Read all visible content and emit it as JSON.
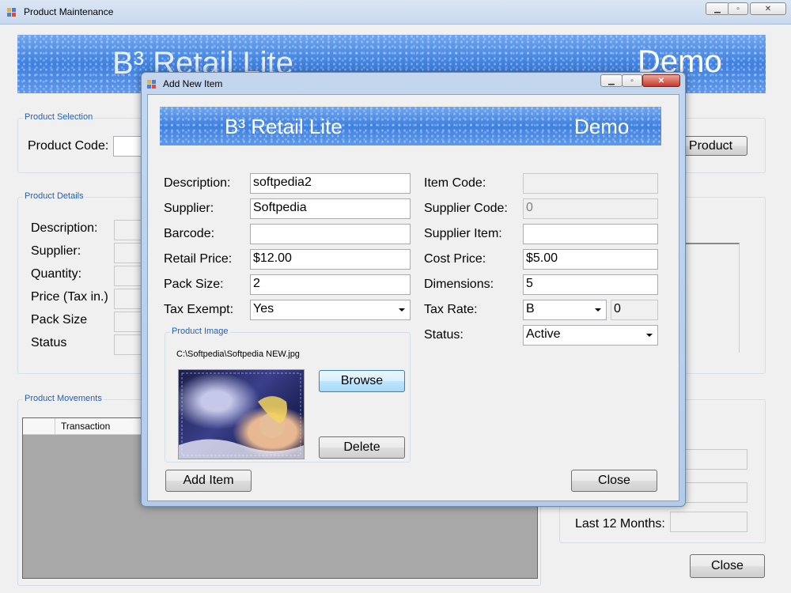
{
  "main_window": {
    "title": "Product Maintenance",
    "banner": {
      "brand": "B³ Retail Lite",
      "edition": "Demo"
    },
    "product_selection": {
      "group_label": "Product Selection",
      "code_label": "Product Code:",
      "button_label": "Product"
    },
    "product_details": {
      "group_label": "Product Details",
      "labels": [
        "Description:",
        "Supplier:",
        "Quantity:",
        "Price (Tax in.)",
        "Pack Size",
        "Status"
      ]
    },
    "product_movements": {
      "group_label": "Product Movements",
      "column_transaction": "Transaction"
    },
    "stats": {
      "last12_label": "Last 12 Months:"
    },
    "close_label": "Close"
  },
  "dialog": {
    "title": "Add New Item",
    "banner": {
      "brand": "B³ Retail Lite",
      "edition": "Demo"
    },
    "fields": {
      "description": {
        "label": "Description:",
        "value": "softpedia2"
      },
      "supplier": {
        "label": "Supplier:",
        "value": "Softpedia"
      },
      "barcode": {
        "label": "Barcode:",
        "value": ""
      },
      "retail_price": {
        "label": "Retail Price:",
        "value": "$12.00"
      },
      "pack_size": {
        "label": "Pack Size:",
        "value": "2"
      },
      "tax_exempt": {
        "label": "Tax Exempt:",
        "value": "Yes"
      },
      "item_code": {
        "label": "Item Code:",
        "value": ""
      },
      "supplier_code": {
        "label": "Supplier Code:",
        "value": "0"
      },
      "supplier_item": {
        "label": "Supplier Item:",
        "value": ""
      },
      "cost_price": {
        "label": "Cost Price:",
        "value": "$5.00"
      },
      "dimensions": {
        "label": "Dimensions:",
        "value": "5"
      },
      "tax_rate": {
        "label": "Tax Rate:",
        "value": "B",
        "rate_value": "0"
      },
      "status": {
        "label": "Status:",
        "value": "Active"
      }
    },
    "product_image": {
      "group_label": "Product Image",
      "path": "C:\\Softpedia\\Softpedia NEW.jpg",
      "browse_label": "Browse",
      "delete_label": "Delete"
    },
    "add_item_label": "Add Item",
    "close_label": "Close"
  },
  "colors": {
    "accent": "#3e80df",
    "group_label": "#1f5fbf",
    "close_red": "#c7392b"
  }
}
